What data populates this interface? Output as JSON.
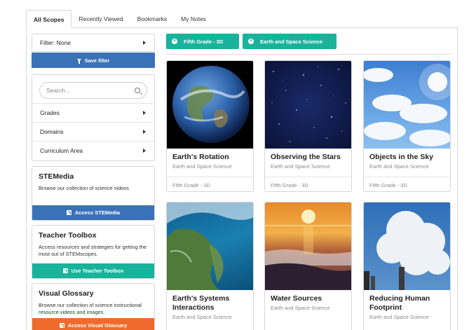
{
  "tabs": [
    {
      "label": "All Scopes",
      "active": true
    },
    {
      "label": "Recently Viewed",
      "active": false
    },
    {
      "label": "Bookmarks",
      "active": false
    },
    {
      "label": "My Notes",
      "active": false
    }
  ],
  "sidebar": {
    "filter_label": "Filter: None",
    "save_filter_label": "Save filter",
    "search_placeholder": "Search...",
    "facets": [
      "Grades",
      "Domains",
      "Curriculum Area"
    ],
    "stemedia": {
      "title": "STEMedia",
      "desc": "Browse our collection of science videos",
      "button": "Access STEMedia",
      "color": "#3a72b8"
    },
    "toolbox": {
      "title": "Teacher Toolbox",
      "desc": "Access resources and strategies for getting the most out of STEMscopes.",
      "button": "Use Teacher Toolbox",
      "color": "#19b39c"
    },
    "glossary": {
      "title": "Visual Glossary",
      "desc": "Browse our collection of science instructional resource videos and images.",
      "button": "Access Visual Glossary",
      "color": "#ef6b2d"
    }
  },
  "chips": [
    {
      "label": "Fifth Grade - 3D"
    },
    {
      "label": "Earth and Space Science"
    }
  ],
  "cards": [
    {
      "title": "Earth's Rotation",
      "subject": "Earth and Space Science",
      "grade": "Fifth Grade - 3D",
      "image": "earth-globe"
    },
    {
      "title": "Observing the Stars",
      "subject": "Earth and Space Science",
      "grade": "Fifth Grade - 3D",
      "image": "starfield"
    },
    {
      "title": "Objects in the Sky",
      "subject": "Earth and Space Science",
      "grade": "Fifth Grade - 3D",
      "image": "sunny-sky"
    },
    {
      "title": "Earth's Systems Interactions",
      "subject": "Earth and Space Science",
      "grade": "",
      "image": "earth-from-orbit"
    },
    {
      "title": "Water Sources",
      "subject": "Earth and Space Science",
      "grade": "",
      "image": "ocean-sunset"
    },
    {
      "title": "Reducing Human Footprint",
      "subject": "Earth and Space Science",
      "grade": "",
      "image": "smokestack"
    }
  ],
  "colors": {
    "blue": "#3a72b8",
    "teal": "#19b39c",
    "orange": "#ef6b2d"
  }
}
